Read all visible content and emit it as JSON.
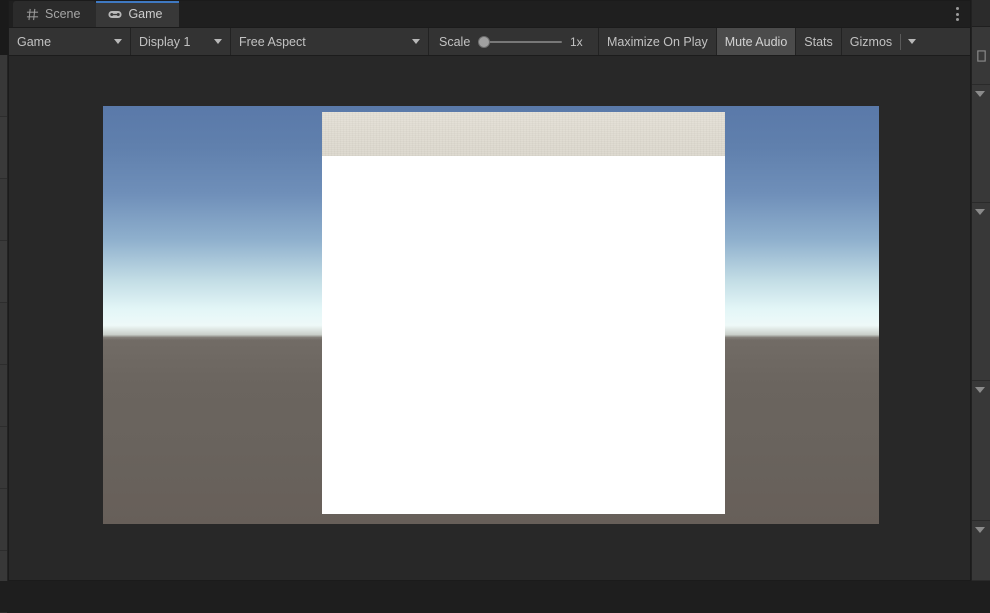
{
  "window": {
    "background_color": "#1a1a1a"
  },
  "tabs": [
    {
      "label": "Scene",
      "icon": "grid-icon",
      "active": false
    },
    {
      "label": "Game",
      "icon": "gamepad-icon",
      "active": true
    }
  ],
  "tabbar": {
    "menu_icon": "kebab-menu-icon"
  },
  "toolbar": {
    "game_target": "Game",
    "display": "Display 1",
    "aspect": "Free Aspect",
    "scale_label": "Scale",
    "scale_value": "1x",
    "scale_slider_position_pct": 0,
    "maximize_on_play": "Maximize On Play",
    "mute_audio": "Mute Audio",
    "mute_audio_active": true,
    "stats": "Stats",
    "gizmos": "Gizmos",
    "gizmos_caret_icon": "chevron-down-icon"
  },
  "game_view": {
    "sky_top_color": "#5a79a9",
    "sky_horizon_color": "#eef9f8",
    "ground_color": "#69635d",
    "panel_header_color": "#e0dcd2",
    "panel_body_color": "#ffffff",
    "accent_color": "#3f79c2"
  }
}
